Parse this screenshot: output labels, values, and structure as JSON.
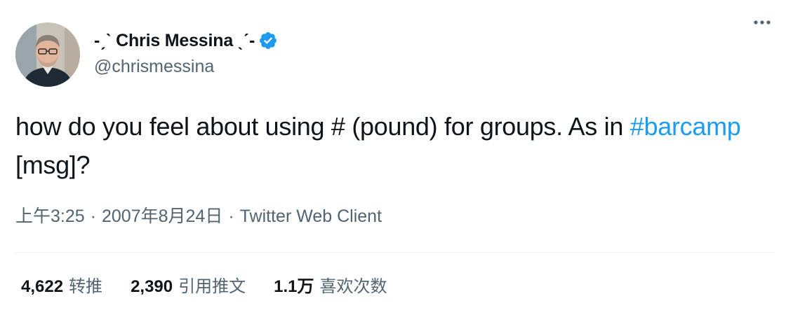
{
  "tweet": {
    "author": {
      "display_name": "-ˏˋ Chris Messina ˎˊ-",
      "handle": "@chrismessina",
      "verified": true
    },
    "text_before": "how do you feel about using # (pound) for groups. As in ",
    "hashtag": "#barcamp",
    "text_after": " [msg]?",
    "meta": {
      "time": "上午3:25",
      "separator": "·",
      "date": "2007年8月24日",
      "source": "Twitter Web Client"
    },
    "stats": [
      {
        "count": "4,622",
        "label": "转推"
      },
      {
        "count": "2,390",
        "label": "引用推文"
      },
      {
        "count": "1.1万",
        "label": "喜欢次数"
      }
    ]
  },
  "icons": {
    "verified": "verified-badge-icon",
    "more": "more-options-icon"
  },
  "colors": {
    "accent": "#1d9bf0",
    "text_primary": "#0f1419",
    "text_secondary": "#536471",
    "divider": "#eff3f4"
  }
}
